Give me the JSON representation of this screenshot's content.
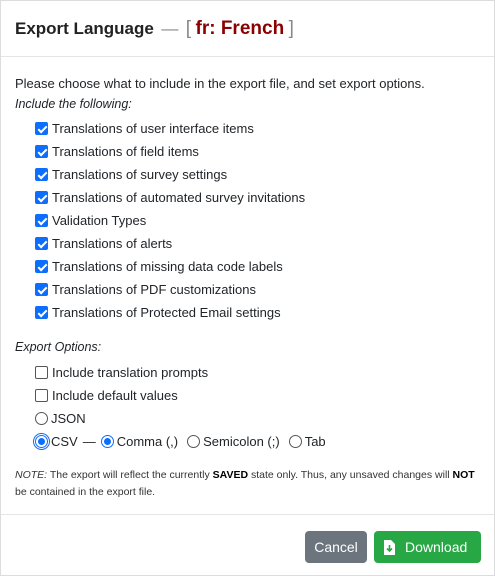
{
  "header": {
    "title": "Export Language",
    "dash": "—",
    "bracket_open": "[",
    "language": "fr: French",
    "bracket_close": "]"
  },
  "intro": "Please choose what to include in the export file, and set export options.",
  "include_label": "Include the following:",
  "include_items": [
    {
      "label": "Translations of user interface items",
      "checked": true
    },
    {
      "label": "Translations of field items",
      "checked": true
    },
    {
      "label": "Translations of survey settings",
      "checked": true
    },
    {
      "label": "Translations of automated survey invitations",
      "checked": true
    },
    {
      "label": "Validation Types",
      "checked": true
    },
    {
      "label": "Translations of alerts",
      "checked": true
    },
    {
      "label": "Translations of missing data code labels",
      "checked": true
    },
    {
      "label": "Translations of PDF customizations",
      "checked": true
    },
    {
      "label": "Translations of Protected Email settings",
      "checked": true
    }
  ],
  "options_label": "Export Options:",
  "options": {
    "translation_prompts": {
      "label": "Include translation prompts",
      "checked": false
    },
    "default_values": {
      "label": "Include default values",
      "checked": false
    },
    "format_json": {
      "label": "JSON",
      "selected": false
    },
    "format_csv": {
      "label": "CSV",
      "selected": true
    },
    "csv_sep_dash": "—",
    "delimiters": [
      {
        "label": "Comma (,)",
        "selected": true
      },
      {
        "label": "Semicolon (;)",
        "selected": false
      },
      {
        "label": "Tab",
        "selected": false
      }
    ]
  },
  "note": {
    "prefix": "NOTE:",
    "text1": " The export will reflect the currently ",
    "bold1": "SAVED",
    "text2": " state only. Thus, any unsaved changes will ",
    "bold2": "NOT",
    "text3": " be contained in the export file."
  },
  "buttons": {
    "cancel": "Cancel",
    "download": "Download"
  },
  "colors": {
    "language": "#8b0000",
    "primary": "#0d6efd",
    "cancel_bg": "#6c757d",
    "download_bg": "#28a745"
  }
}
